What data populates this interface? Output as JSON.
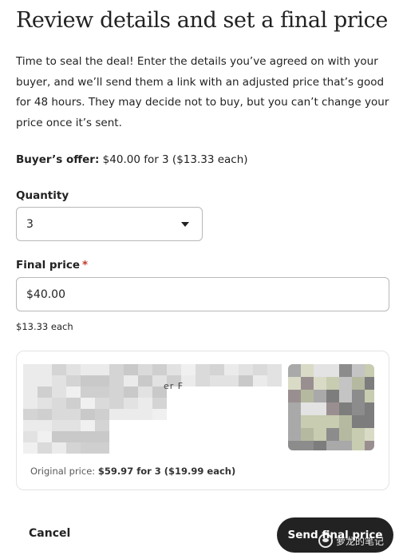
{
  "header": {
    "title": "Review details and set a final price"
  },
  "intro": {
    "text": "Time to seal the deal! Enter the details you’ve agreed on with your buyer, and we’ll send them a link with an adjusted price that’s good for 48 hours. They may decide not to buy, but you can’t change your price once it’s sent."
  },
  "offer": {
    "label": "Buyer’s offer:",
    "value": "$40.00 for 3 ($13.33 each)"
  },
  "quantity": {
    "label": "Quantity",
    "value": "3"
  },
  "final_price": {
    "label": "Final price",
    "required_mark": "*",
    "value": "$40.00",
    "each": "$13.33 each"
  },
  "listing": {
    "partial_text": "er F",
    "original_label": "Original price:",
    "original_value": "$59.97 for 3 ($19.99 each)"
  },
  "actions": {
    "cancel_label": "Cancel",
    "send_label": "Send final price"
  },
  "watermark": {
    "text": "萝龙的笔记"
  },
  "colors": {
    "required": "#c0392b",
    "primary_button": "#222222",
    "border": "#b8b8b8"
  }
}
